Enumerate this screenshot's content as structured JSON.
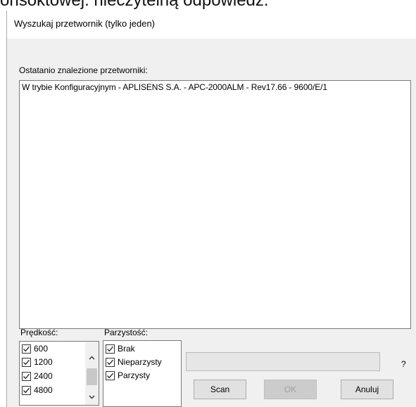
{
  "background_caption": "onsoktowej. niecźytelną odpowiedź.",
  "dialog": {
    "title": "Wyszukaj przetwornik (tylko jeden)",
    "found_label": "Ostatanio znalezione przetworniki:",
    "found_items": [
      "W trybie Konfiguracyjnym - APLISENS S.A. - APC-2000ALM - Rev17.66 - 9600/E/1"
    ],
    "speed": {
      "label": "Prędkość:",
      "options": [
        {
          "label": "600",
          "checked": true
        },
        {
          "label": "1200",
          "checked": true
        },
        {
          "label": "2400",
          "checked": true
        },
        {
          "label": "4800",
          "checked": true
        }
      ]
    },
    "parity": {
      "label": "Parzystość:",
      "options": [
        {
          "label": "Brak",
          "checked": true
        },
        {
          "label": "Nieparzysty",
          "checked": true
        },
        {
          "label": "Parzysty",
          "checked": true
        }
      ]
    },
    "progress": 0,
    "help_label": "?",
    "buttons": {
      "scan": "Scan",
      "ok": "OK",
      "cancel": "Anuluj"
    }
  }
}
